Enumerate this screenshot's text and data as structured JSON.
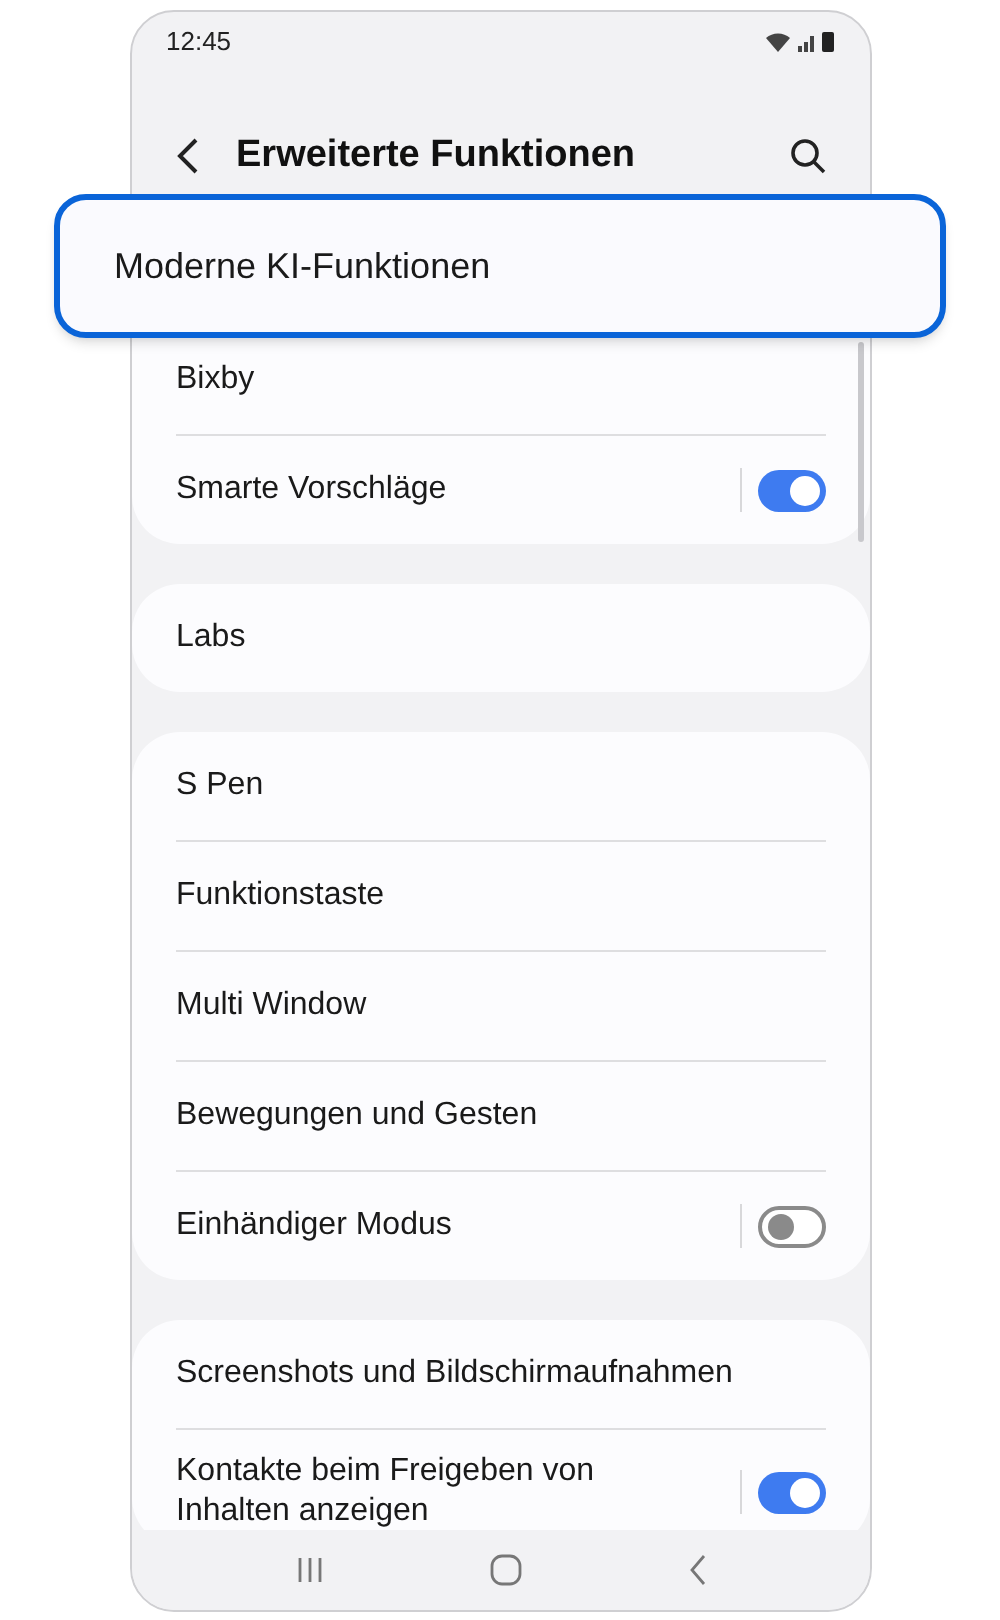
{
  "status_bar": {
    "time": "12:45"
  },
  "header": {
    "title": "Erweiterte Funktionen"
  },
  "highlight": {
    "label": "Moderne KI-Funktionen"
  },
  "groups": [
    {
      "items": [
        {
          "label": "Bixby",
          "kind": "link"
        },
        {
          "label": "Smarte Vorschläge",
          "kind": "toggle",
          "on": true
        }
      ]
    },
    {
      "items": [
        {
          "label": "Labs",
          "kind": "link"
        }
      ]
    },
    {
      "items": [
        {
          "label": "S Pen",
          "kind": "link"
        },
        {
          "label": "Funktionstaste",
          "kind": "link"
        },
        {
          "label": "Multi Window",
          "kind": "link"
        },
        {
          "label": "Bewegungen und Gesten",
          "kind": "link"
        },
        {
          "label": "Einhändiger Modus",
          "kind": "toggle",
          "on": false
        }
      ]
    },
    {
      "items": [
        {
          "label": "Screenshots und Bildschirmaufnahmen",
          "kind": "link"
        },
        {
          "label": "Kontakte beim Freigeben von Inhalten anzeigen",
          "kind": "toggle",
          "on": true
        }
      ]
    }
  ]
}
